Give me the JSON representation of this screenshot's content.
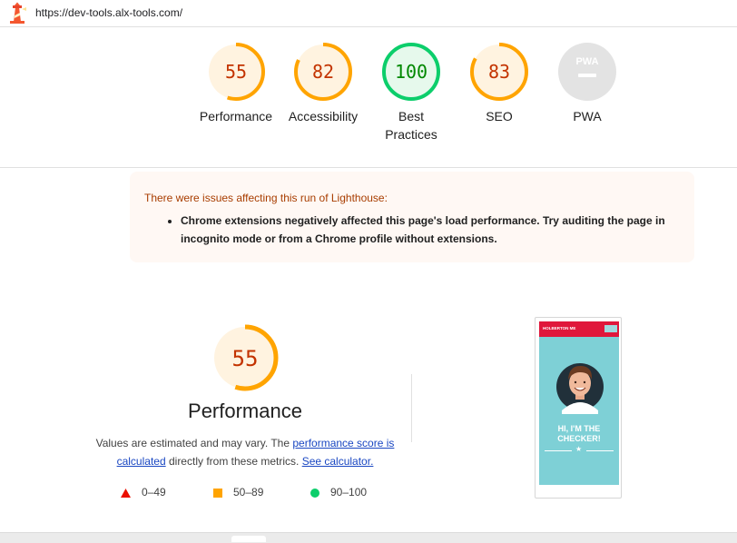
{
  "header": {
    "url": "https://dev-tools.alx-tools.com/"
  },
  "colors": {
    "average": "#ffa400",
    "average_text": "#c33300",
    "pass": "#0cce6b",
    "pass_text": "#008800",
    "fail": "#ff4e42",
    "na": "#e0e0e0"
  },
  "gauges": [
    {
      "score": "55",
      "score_value": 55,
      "label": "Performance",
      "rating": "average"
    },
    {
      "score": "82",
      "score_value": 82,
      "label": "Accessibility",
      "rating": "average"
    },
    {
      "score": "100",
      "score_value": 100,
      "label": "Best Practices",
      "rating": "pass"
    },
    {
      "score": "83",
      "score_value": 83,
      "label": "SEO",
      "rating": "average"
    },
    {
      "score": "PWA",
      "score_value": null,
      "label": "PWA",
      "rating": "na"
    }
  ],
  "warning": {
    "title": "There were issues affecting this run of Lighthouse:",
    "items": [
      "Chrome extensions negatively affected this page's load performance. Try auditing the page in incognito mode or from a Chrome profile without extensions."
    ]
  },
  "performance": {
    "score": "55",
    "score_value": 55,
    "title": "Performance",
    "desc_before": "Values are estimated and may vary. The ",
    "desc_link1": "performance score is calculated",
    "desc_middle": " directly from these metrics. ",
    "desc_link2": "See calculator.",
    "legend": [
      {
        "range": "0–49",
        "shape": "triangle"
      },
      {
        "range": "50–89",
        "shape": "square"
      },
      {
        "range": "90–100",
        "shape": "circle"
      }
    ]
  },
  "screenshot": {
    "brand": "HOLBERTON ME",
    "headline_1": "HI, I'M THE",
    "headline_2": "CHECKER!",
    "star": "★"
  }
}
